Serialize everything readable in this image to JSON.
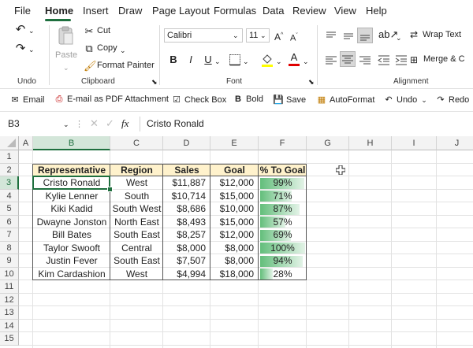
{
  "menu": [
    "File",
    "Home",
    "Insert",
    "Draw",
    "Page Layout",
    "Formulas",
    "Data",
    "Review",
    "View",
    "Help"
  ],
  "ribbon": {
    "undo_group_label": "Undo",
    "clipboard": {
      "paste": "Paste",
      "cut": "Cut",
      "copy": "Copy",
      "format_painter": "Format Painter",
      "label": "Clipboard"
    },
    "font": {
      "name": "Calibri",
      "size": "11",
      "label": "Font",
      "bold": "B",
      "italic": "I",
      "underline": "U",
      "font_color_glyph": "A"
    },
    "alignment": {
      "wrap_text": "Wrap Text",
      "merge": "Merge & C",
      "label": "Alignment"
    }
  },
  "qat": [
    {
      "icon": "email-icon",
      "label": "Email"
    },
    {
      "icon": "pdf-icon",
      "label": "E-mail as PDF Attachment"
    },
    {
      "icon": "checkbox-icon",
      "label": "Check Box"
    },
    {
      "icon": "bold-icon",
      "label": "Bold"
    },
    {
      "icon": "save-icon",
      "label": "Save"
    },
    {
      "icon": "autoformat-icon",
      "label": "AutoFormat"
    },
    {
      "icon": "undo-icon",
      "label": "Undo"
    },
    {
      "icon": "redo-icon",
      "label": "Redo"
    }
  ],
  "formula_bar": {
    "name_box": "B3",
    "fx": "fx",
    "content": "Cristo Ronald"
  },
  "columns": [
    "A",
    "B",
    "C",
    "D",
    "E",
    "F",
    "G",
    "H",
    "I",
    "J"
  ],
  "rows": [
    "1",
    "2",
    "3",
    "4",
    "5",
    "6",
    "7",
    "8",
    "9",
    "10",
    "11",
    "12",
    "13",
    "14",
    "15"
  ],
  "table": {
    "headers": [
      "Representative",
      "Region",
      "Sales",
      "Goal",
      "% To Goal"
    ],
    "rows": [
      {
        "rep": "Cristo Ronald",
        "region": "West",
        "sales": "$11,887",
        "goal": "$12,000",
        "pct": "99%",
        "fill": 0.99
      },
      {
        "rep": "Kylie Lenner",
        "region": "South",
        "sales": "$10,714",
        "goal": "$15,000",
        "pct": "71%",
        "fill": 0.71
      },
      {
        "rep": "Kiki Kadid",
        "region": "South West",
        "sales": "$8,686",
        "goal": "$10,000",
        "pct": "87%",
        "fill": 0.87
      },
      {
        "rep": "Dwayne Jonston",
        "region": "North East",
        "sales": "$8,493",
        "goal": "$15,000",
        "pct": "57%",
        "fill": 0.57
      },
      {
        "rep": "Bill Bates",
        "region": "South East",
        "sales": "$8,257",
        "goal": "$12,000",
        "pct": "69%",
        "fill": 0.69
      },
      {
        "rep": "Taylor Swooft",
        "region": "Central",
        "sales": "$8,000",
        "goal": "$8,000",
        "pct": "100%",
        "fill": 1.0
      },
      {
        "rep": "Justin Fever",
        "region": "South East",
        "sales": "$7,507",
        "goal": "$8,000",
        "pct": "94%",
        "fill": 0.94
      },
      {
        "rep": "Kim Cardashion",
        "region": "West",
        "sales": "$4,994",
        "goal": "$18,000",
        "pct": "28%",
        "fill": 0.28
      }
    ]
  },
  "active_cell": "B3",
  "colors": {
    "accent": "#1e6f3e",
    "header_fill": "#fff2cc",
    "databar": "#63be7b"
  }
}
